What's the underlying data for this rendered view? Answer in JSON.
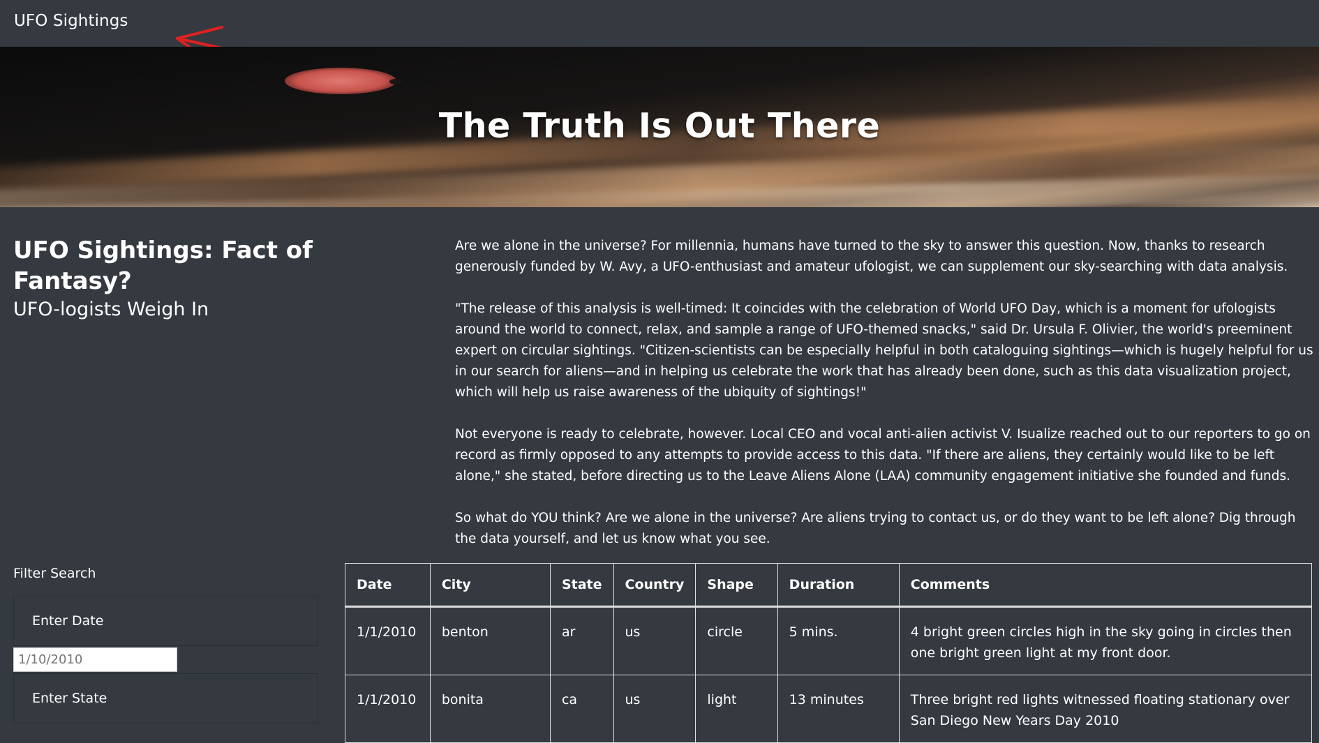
{
  "navbar": {
    "brand": "UFO Sightings"
  },
  "hero": {
    "title": "The Truth Is Out There"
  },
  "intro": {
    "heading": "UFO Sightings: Fact of Fantasy?",
    "subheading": "UFO-logists Weigh In"
  },
  "article": {
    "paragraphs": [
      "Are we alone in the universe? For millennia, humans have turned to the sky to answer this question. Now, thanks to research generously funded by W. Avy, a UFO-enthusiast and amateur ufologist, we can supplement our sky-searching with data analysis.",
      "\"The release of this analysis is well-timed: It coincides with the celebration of World UFO Day, which is a moment for ufologists around the world to connect, relax, and sample a range of UFO-themed snacks,\" said Dr. Ursula F. Olivier, the world's preeminent expert on circular sightings. \"Citizen-scientists can be especially helpful in both cataloguing sightings—which is hugely helpful for us in our search for aliens—and in helping us celebrate the work that has already been done, such as this data visualization project, which will help us raise awareness of the ubiquity of sightings!\"",
      "Not everyone is ready to celebrate, however. Local CEO and vocal anti-alien activist V. Isualize reached out to our reporters to go on record as firmly opposed to any attempts to provide access to this data. \"If there are aliens, they certainly would like to be left alone,\" she stated, before directing us to the Leave Aliens Alone (LAA) community engagement initiative she founded and funds.",
      "So what do YOU think? Are we alone in the universe? Are aliens trying to contact us, or do they want to be left alone? Dig through the data yourself, and let us know what you see."
    ]
  },
  "filters": {
    "title": "Filter Search",
    "date_label": "Enter Date",
    "date_placeholder": "1/10/2010",
    "state_label": "Enter State"
  },
  "table": {
    "headers": [
      "Date",
      "City",
      "State",
      "Country",
      "Shape",
      "Duration",
      "Comments"
    ],
    "rows": [
      [
        "1/1/2010",
        "benton",
        "ar",
        "us",
        "circle",
        "5 mins.",
        "4 bright green circles high in the sky going in circles then one bright green light at my front door."
      ],
      [
        "1/1/2010",
        "bonita",
        "ca",
        "us",
        "light",
        "13 minutes",
        "Three bright red lights witnessed floating stationary over San Diego New Years Day 2010"
      ]
    ]
  },
  "colors": {
    "page_background": "#343a40",
    "text": "#ffffff",
    "annotation_arrow": "#e02020"
  }
}
